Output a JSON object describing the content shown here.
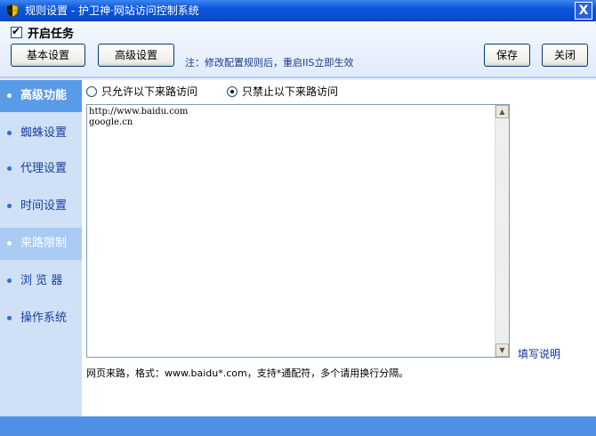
{
  "window": {
    "title": "规则设置 - 护卫神·网站访问控制系统",
    "close_label": "X",
    "colors": {
      "titlebar": "#0b55d9",
      "sidebar": "#cfe0f7",
      "active": "#5a9be8",
      "statusbar": "#4f8fe6"
    }
  },
  "topbar": {
    "enable_label": "开启任务",
    "enable_checked": true,
    "basic_button": "基本设置",
    "advanced_button": "高级设置",
    "note": "注：修改配置规则后，重启IIS立即生效",
    "save_button": "保存",
    "close_button": "关闭"
  },
  "sidebar": {
    "items": [
      {
        "label": "高级功能",
        "state": "active"
      },
      {
        "label": "蜘蛛设置",
        "state": "normal"
      },
      {
        "label": "代理设置",
        "state": "normal"
      },
      {
        "label": "时间设置",
        "state": "normal"
      },
      {
        "label": "来路限制",
        "state": "hover"
      },
      {
        "label": "浏 览 器",
        "state": "normal"
      },
      {
        "label": "操作系统",
        "state": "normal"
      }
    ]
  },
  "main": {
    "allow_option": "只允许以下来路访问",
    "deny_option": "只禁止以下来路访问",
    "selected_option": "deny",
    "textarea_value": "http://www.baidu.com\ngoogle.cn",
    "help_link": "填写说明",
    "format_text": "网页来路，格式：www.baidu*.com，支持*通配符，多个请用换行分隔。"
  }
}
